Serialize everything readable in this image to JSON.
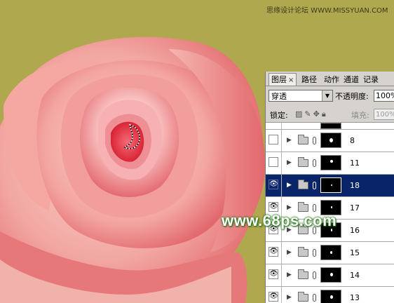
{
  "watermark_top": "思缘设计论坛 WWW.MISSYUAN.COM",
  "watermark_site": "www.68ps.com",
  "colors": {
    "background": "#b0a84e",
    "selection": "#0a246a",
    "panel": "#d6d3ce"
  },
  "panel": {
    "tabs": [
      {
        "label": "图层",
        "close": "×",
        "active": true
      },
      {
        "label": "路径"
      },
      {
        "label": "动作"
      },
      {
        "label": "通道"
      },
      {
        "label": "记录"
      }
    ],
    "blend_mode": "穿透",
    "opacity_label": "不透明度:",
    "opacity_value": "100%",
    "lock_label": "锁定:",
    "fill_label": "填充:",
    "fill_value": "100%",
    "layers": [
      {
        "name": "8",
        "visible": false,
        "selected": false
      },
      {
        "name": "11",
        "visible": false,
        "selected": false
      },
      {
        "name": "18",
        "visible": true,
        "selected": true
      },
      {
        "name": "17",
        "visible": true,
        "selected": false
      },
      {
        "name": "16",
        "visible": true,
        "selected": false
      },
      {
        "name": "15",
        "visible": true,
        "selected": false
      },
      {
        "name": "14",
        "visible": true,
        "selected": false
      },
      {
        "name": "13",
        "visible": true,
        "selected": false
      }
    ]
  }
}
